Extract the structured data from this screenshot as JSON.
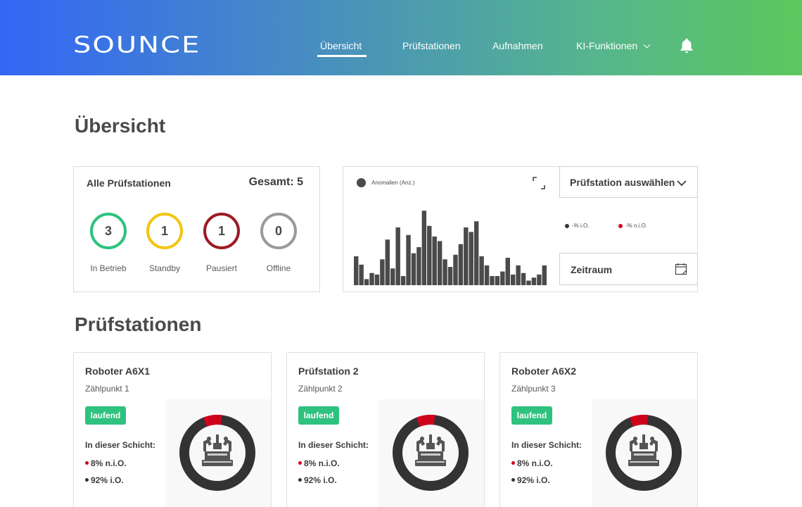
{
  "header": {
    "logo": "SOUNCE",
    "nav": [
      "Übersicht",
      "Prüfstationen",
      "Aufnahmen",
      "KI-Funktionen"
    ],
    "active_index": 0
  },
  "overview": {
    "title": "Übersicht",
    "stations_card": {
      "title": "Alle Prüfstationen",
      "total": "Gesamt: 5",
      "statuses": [
        {
          "count": "3",
          "label": "In Betrieb",
          "color": "#2ec27e"
        },
        {
          "count": "1",
          "label": "Standby",
          "color": "#f2c511"
        },
        {
          "count": "1",
          "label": "Pausiert",
          "color": "#9b1b22"
        },
        {
          "count": "0",
          "label": "Offline",
          "color": "#9a9a9a"
        }
      ]
    },
    "chart": {
      "legend": "Anomalien (Anz.)",
      "station_select": "Prüfstation auswählen",
      "rate_legend": [
        {
          "label": "-% i.O.",
          "color": "#333333"
        },
        {
          "label": "-% n.i.O.",
          "color": "#d0021b"
        }
      ],
      "period_label": "Zeitraum"
    }
  },
  "chart_data": {
    "type": "bar",
    "series": [
      {
        "name": "Anomalien (Anz.)",
        "values": [
          38,
          27,
          8,
          16,
          14,
          34,
          60,
          22,
          76,
          12,
          66,
          42,
          50,
          98,
          78,
          64,
          58,
          34,
          24,
          40,
          54,
          76,
          70,
          84,
          38,
          26,
          12,
          12,
          18,
          36,
          14,
          26,
          16,
          6,
          10,
          14,
          26
        ]
      }
    ],
    "ylim": [
      0,
      100
    ],
    "color": "#4a4a4a"
  },
  "stations": {
    "title": "Prüfstationen",
    "items": [
      {
        "name": "Roboter A6X1",
        "sub": "Zählpunkt 1",
        "status": "laufend",
        "shift_label": "In dieser Schicht:",
        "nio": "8% n.i.O.",
        "io": "92% i.O.",
        "nio_share": 0.08
      },
      {
        "name": "Prüfstation 2",
        "sub": "Zählpunkt 2",
        "status": "laufend",
        "shift_label": "In dieser Schicht:",
        "nio": "8% n.i.O.",
        "io": "92% i.O.",
        "nio_share": 0.08
      },
      {
        "name": "Roboter A6X2",
        "sub": "Zählpunkt 3",
        "status": "laufend",
        "shift_label": "In dieser Schicht:",
        "nio": "8% n.i.O.",
        "io": "92% i.O.",
        "nio_share": 0.08
      }
    ]
  },
  "colors": {
    "accent_green": "#2ec27e",
    "nio_red": "#d0021b",
    "io_dark": "#333333"
  }
}
